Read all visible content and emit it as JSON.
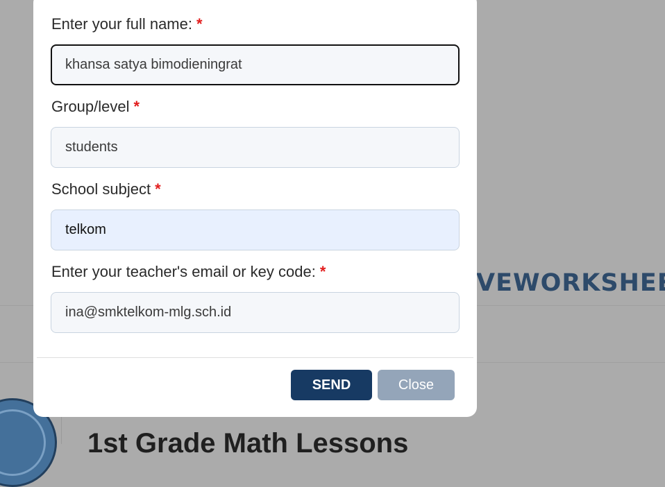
{
  "background": {
    "brand_fragment": "VEWORKSHEET",
    "heading_fragment": "1st Grade Math Lessons"
  },
  "form": {
    "required_marker": "*",
    "fields": [
      {
        "label": "Enter your full name:",
        "value": "khansa satya bimodieningrat",
        "state": "focused"
      },
      {
        "label": "Group/level",
        "value": "students",
        "state": "normal"
      },
      {
        "label": "School subject",
        "value": "telkom",
        "state": "autofilled"
      },
      {
        "label": "Enter your teacher's email or key code:",
        "value": "ina@smktelkom-mlg.sch.id",
        "state": "normal"
      }
    ]
  },
  "buttons": {
    "send_label": "SEND",
    "close_label": "Close"
  },
  "colors": {
    "overlay": "#ababab",
    "required": "#e21d1d",
    "send_button": "#173a63",
    "close_button": "#94a5b9",
    "autofill_field": "#e8f0fe"
  }
}
